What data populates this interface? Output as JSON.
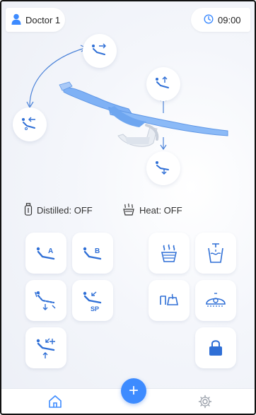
{
  "colors": {
    "accent": "#3d8bff",
    "chair": "#7fb1f5",
    "icon": "#2f6fd6"
  },
  "header": {
    "user_name": "Doctor 1",
    "time": "09:00",
    "user_icon": "person-icon",
    "clock_icon": "clock-icon"
  },
  "status": {
    "distilled_label": "Distilled: OFF",
    "heat_label": "Heat: OFF",
    "distilled_icon": "bottle-icon",
    "heat_icon": "heater-icon"
  },
  "presets": {
    "a_label": "A",
    "b_label": "B",
    "sp_label": "SP"
  },
  "bottom_nav": {
    "home_icon": "home-icon",
    "settings_icon": "gear-icon",
    "add_icon": "plus-icon",
    "add_label": "+"
  }
}
